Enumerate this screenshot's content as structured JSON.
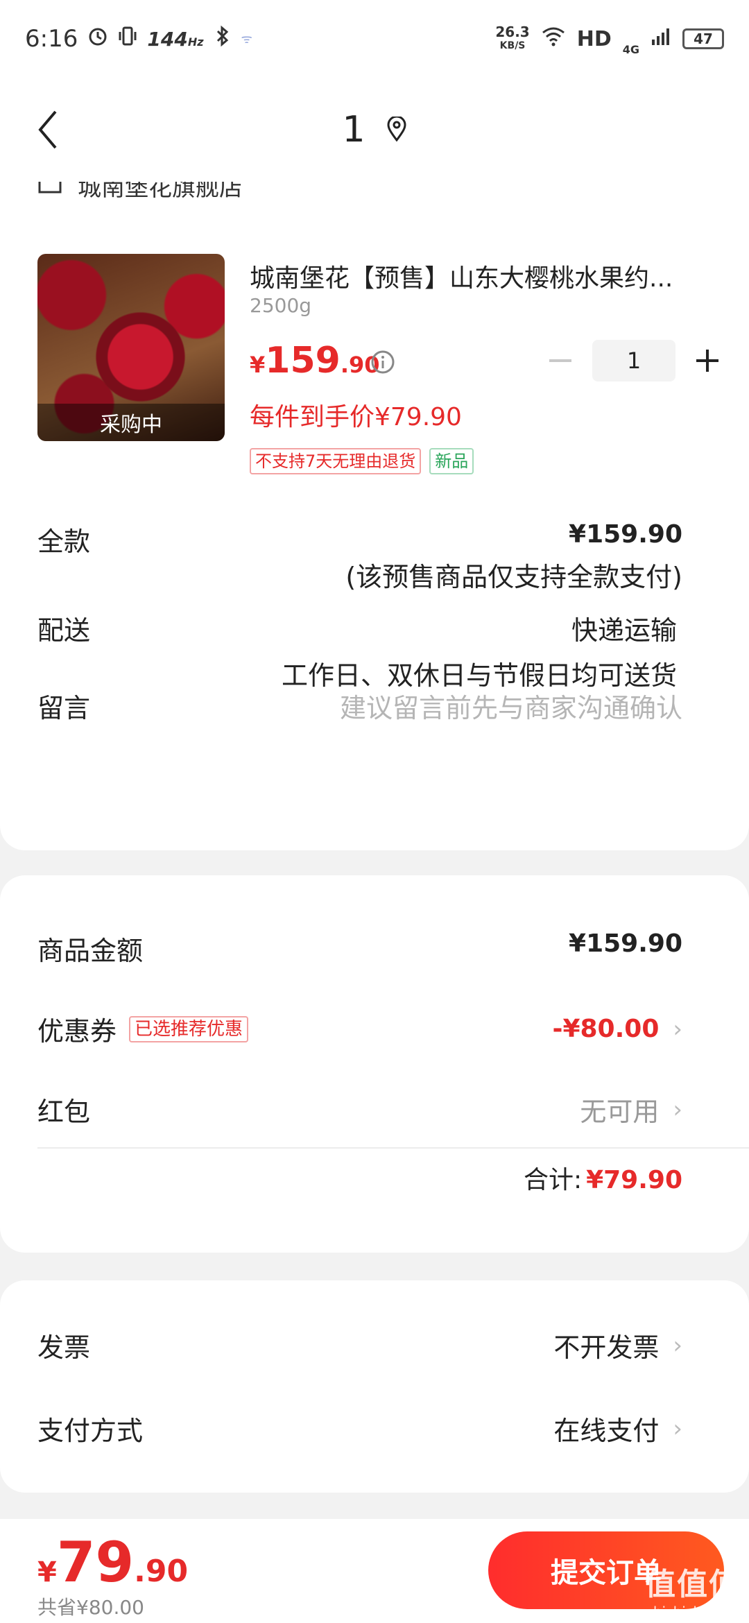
{
  "status_bar": {
    "time": "6:16",
    "refresh_rate": "144",
    "refresh_unit": "Hz",
    "net_speed_value": "26.3",
    "net_speed_unit": "KB/S",
    "hd": "HD",
    "net_type": "4G",
    "battery": "47"
  },
  "nav": {
    "title": "1"
  },
  "store": {
    "name": "城南堡花旗舰店"
  },
  "product": {
    "title": "城南堡花【预售】山东大樱桃水果约...",
    "spec": "2500g",
    "image_overlay": "采购中",
    "price_currency": "¥",
    "price_int": "159",
    "price_dec": ".90",
    "final_price": "每件到手价¥79.90",
    "quantity": "1",
    "tags": [
      "不支持7天无理由退货",
      "新品"
    ]
  },
  "order_rows": {
    "payment_label": "全款",
    "payment_value": "¥159.90",
    "payment_note": "(该预售商品仅支持全款支付)",
    "delivery_label": "配送",
    "delivery_value": "快递运输",
    "delivery_note": "工作日、双休日与节假日均可送货",
    "message_label": "留言",
    "message_placeholder": "建议留言前先与商家沟通确认"
  },
  "summary": {
    "goods_label": "商品金额",
    "goods_value": "¥159.90",
    "coupon_label": "优惠券",
    "coupon_tag": "已选推荐优惠",
    "coupon_value": "-¥80.00",
    "redpacket_label": "红包",
    "redpacket_value": "无可用",
    "total_label": "合计:",
    "total_value": "¥79.90"
  },
  "extras": {
    "invoice_label": "发票",
    "invoice_value": "不开发票",
    "payment_method_label": "支付方式",
    "payment_method_value": "在线支付"
  },
  "bottom": {
    "currency": "¥",
    "price_int": "79",
    "price_dec": ".90",
    "saved": "共省¥80.00",
    "submit_label": "提交订单"
  },
  "watermark": {
    "big": "值值值",
    "small": "zhizhizhi.com"
  },
  "colors": {
    "accent_red": "#e62a2a",
    "button_gradient_start": "#ff2d2d",
    "button_gradient_end": "#ff5a1f",
    "tag_green": "#2aa55a",
    "background": "#f2f2f2"
  }
}
